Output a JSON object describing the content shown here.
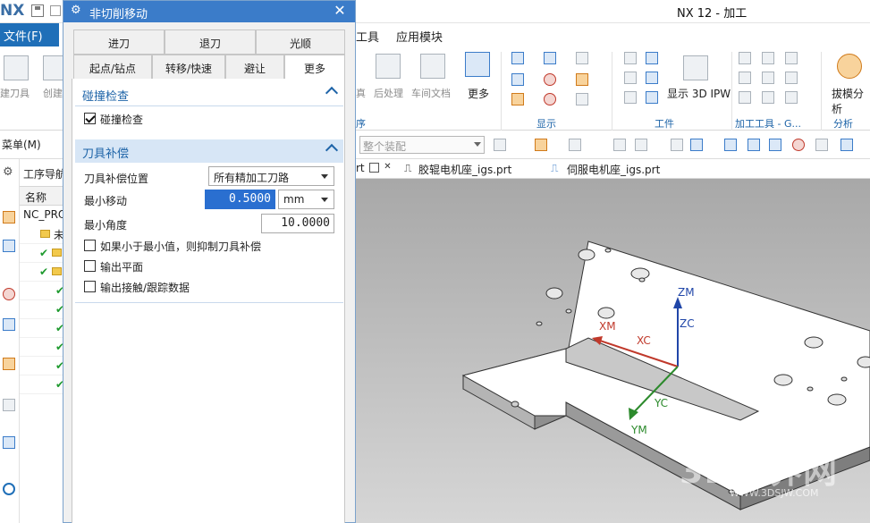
{
  "app": {
    "title": "NX 12 - 加工",
    "logo_text": "NX"
  },
  "menubar": {
    "file_label": "文件(F)",
    "tools_label": "工具",
    "app_module_label": "应用模块"
  },
  "ribbon": {
    "create_tool_label": "建刀具",
    "create_label": "创建",
    "simulate_label": "真",
    "postprocess_label": "后处理",
    "shop_doc_label": "车间文档",
    "more_label": "更多",
    "show_3d_ipw_label": "显示 3D IPW",
    "draft_analysis_label": "拔模分析",
    "group_left_label": "序",
    "group_display_label": "显示",
    "group_workpiece_label": "工件",
    "group_tools_label": "加工工具 - G...",
    "group_analysis_label": "分析"
  },
  "toolbar2": {
    "menu_label": "菜单(M)",
    "assembly_filter": "整个装配"
  },
  "doc_tabs": [
    {
      "label": "rt"
    },
    {
      "label": "胶辊电机座_igs.prt"
    },
    {
      "label": "伺服电机座_igs.prt"
    }
  ],
  "navigator": {
    "title": "工序导航",
    "column_name": "名称",
    "root": "NC_PRO",
    "unused_item": "未"
  },
  "viewport": {
    "axes": {
      "zm": "ZM",
      "zc": "ZC",
      "xm": "XM",
      "xc": "XC",
      "yc": "YC",
      "ym": "YM"
    },
    "watermark": "3D世界网",
    "watermark_url": "WWW.3DSJW.COM"
  },
  "dialog": {
    "title": "非切削移动",
    "tabs_row1": [
      "进刀",
      "退刀",
      "光顺"
    ],
    "tabs_row2": [
      "起点/钻点",
      "转移/快速",
      "避让",
      "更多"
    ],
    "active_tab": "更多",
    "collision": {
      "header": "碰撞检查",
      "checkbox_label": "碰撞检查",
      "checked": true
    },
    "tool_comp": {
      "header": "刀具补偿",
      "position_label": "刀具补偿位置",
      "position_value": "所有精加工刀路",
      "min_move_label": "最小移动",
      "min_move_value": "0.5000",
      "min_move_unit": "mm",
      "min_angle_label": "最小角度",
      "min_angle_value": "10.0000",
      "suppress_label": "如果小于最小值，则抑制刀具补偿",
      "output_plane_label": "输出平面",
      "output_contact_label": "输出接触/跟踪数据",
      "suppress_checked": false,
      "output_plane_checked": false,
      "output_contact_checked": false
    }
  }
}
